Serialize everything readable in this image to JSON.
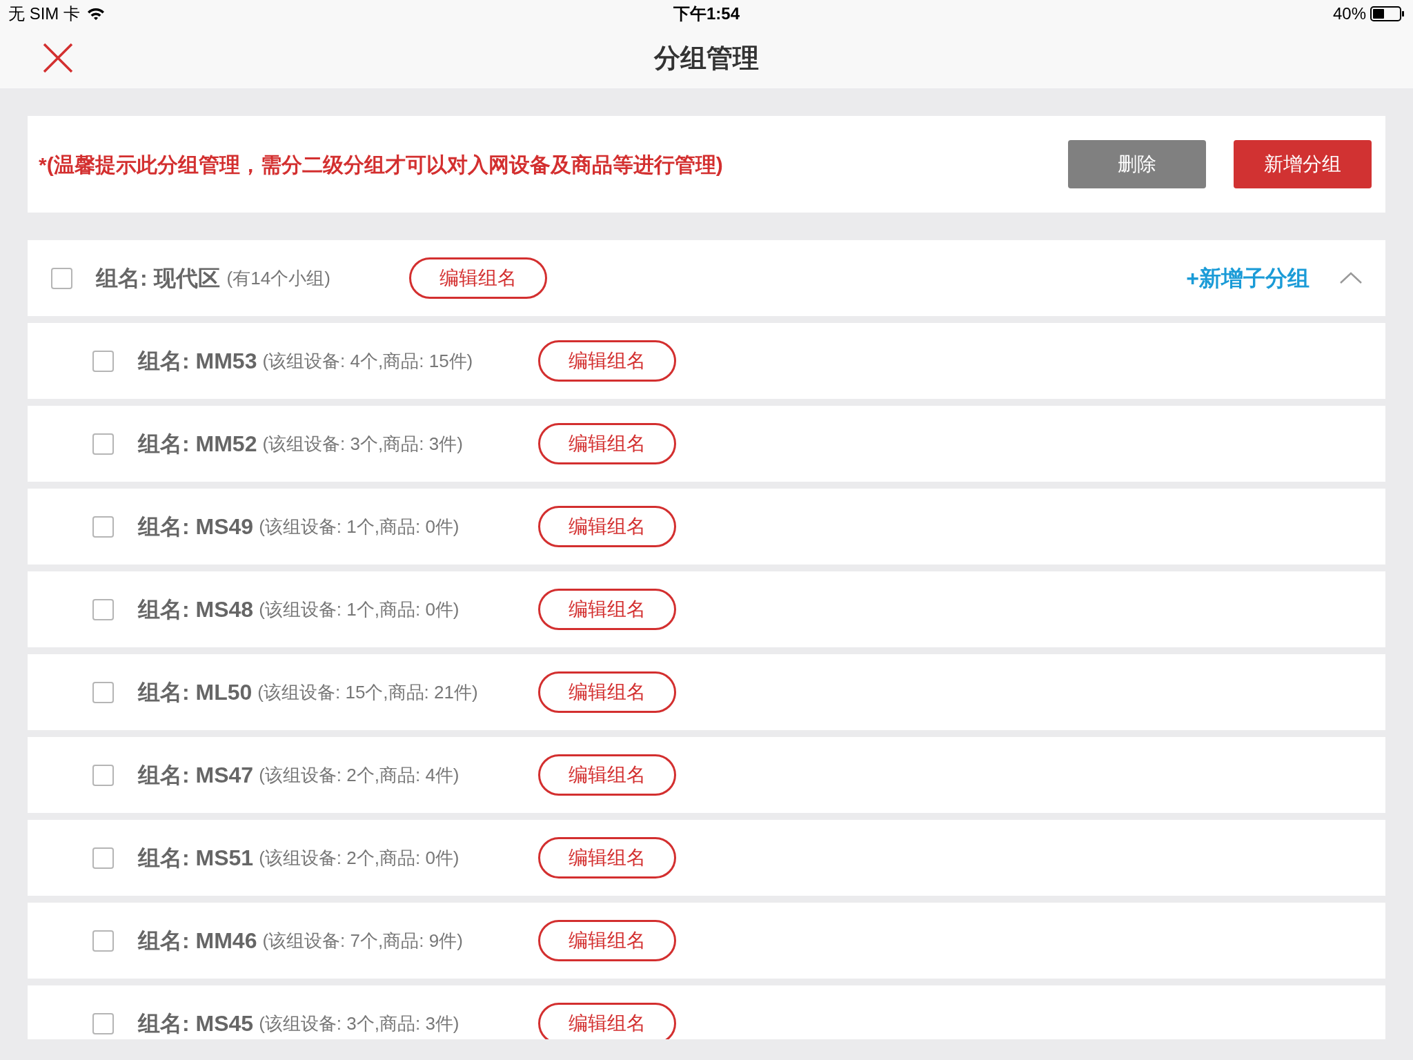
{
  "status_bar": {
    "carrier": "无 SIM 卡",
    "time": "下午1:54",
    "battery": "40%"
  },
  "nav": {
    "title": "分组管理"
  },
  "notice": {
    "text": "*(温馨提示此分组管理，需分二级分组才可以对入网设备及商品等进行管理)",
    "buttons": [
      {
        "label": "删除",
        "kind": "secondary"
      },
      {
        "label": "新增分组",
        "kind": "primary"
      }
    ]
  },
  "group": {
    "name": "组名: 现代区",
    "info": "(有14个小组)",
    "checked": false,
    "edit_label": "编辑组名",
    "add_child_label": "+新增子分组",
    "expanded": true,
    "children": [
      {
        "name": "组名: MM53",
        "info": "(该组设备: 4个,商品: 15件)",
        "checked": false,
        "edit_label": "编辑组名"
      },
      {
        "name": "组名: MM52",
        "info": "(该组设备: 3个,商品: 3件)",
        "checked": false,
        "edit_label": "编辑组名"
      },
      {
        "name": "组名: MS49",
        "info": "(该组设备: 1个,商品: 0件)",
        "checked": false,
        "edit_label": "编辑组名"
      },
      {
        "name": "组名: MS48",
        "info": "(该组设备: 1个,商品: 0件)",
        "checked": false,
        "edit_label": "编辑组名"
      },
      {
        "name": "组名: ML50",
        "info": "(该组设备: 15个,商品: 21件)",
        "checked": false,
        "edit_label": "编辑组名"
      },
      {
        "name": "组名: MS47",
        "info": "(该组设备: 2个,商品: 4件)",
        "checked": false,
        "edit_label": "编辑组名"
      },
      {
        "name": "组名: MS51",
        "info": "(该组设备: 2个,商品: 0件)",
        "checked": false,
        "edit_label": "编辑组名"
      },
      {
        "name": "组名: MM46",
        "info": "(该组设备: 7个,商品: 9件)",
        "checked": false,
        "edit_label": "编辑组名"
      },
      {
        "name": "组名: MS45",
        "info": "(该组设备: 3个,商品: 3件)",
        "checked": false,
        "edit_label": "编辑组名"
      }
    ]
  }
}
